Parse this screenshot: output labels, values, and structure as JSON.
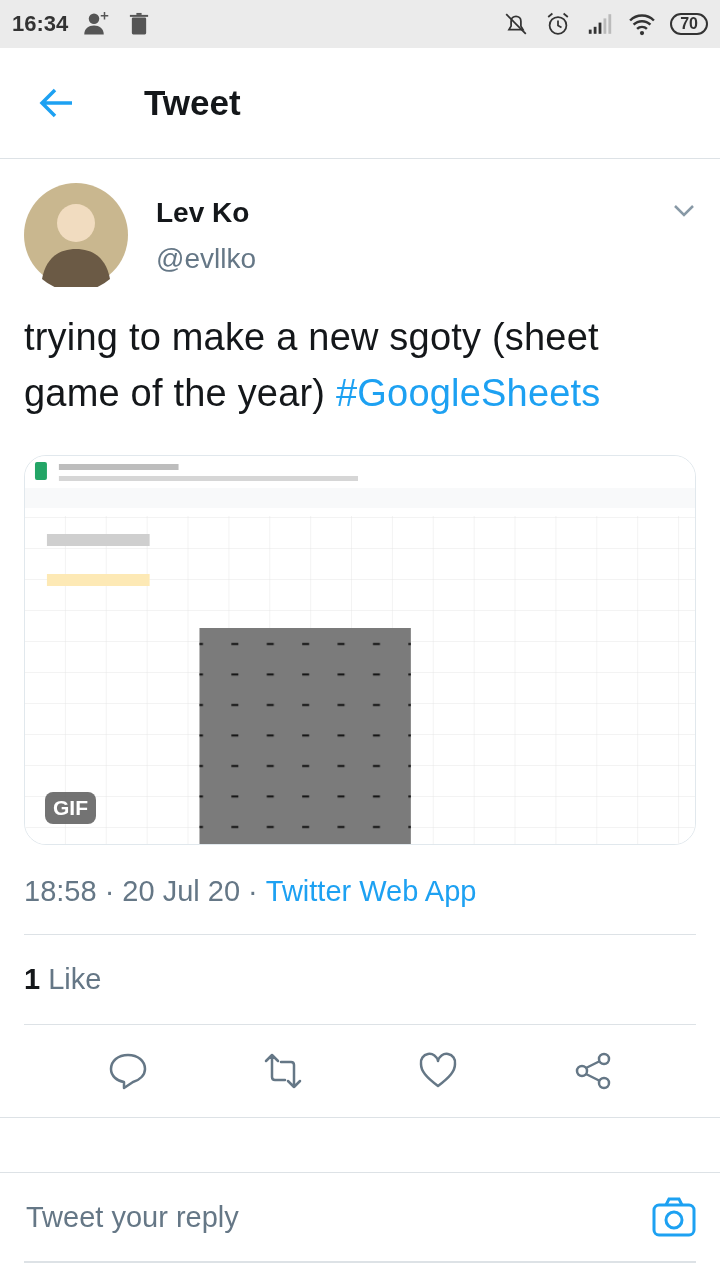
{
  "status_bar": {
    "time": "16:34",
    "battery": "70"
  },
  "header": {
    "title": "Tweet"
  },
  "tweet": {
    "author": {
      "name": "Lev Ko",
      "handle": "@evllko"
    },
    "text": "trying to make a new sgoty (sheet game of the year)",
    "hashtag": "#GoogleSheets",
    "media": {
      "kind": "picture",
      "badge": "GIF"
    },
    "timestamp": "18:58 · 20 Jul 20 ·",
    "source": "Twitter Web App",
    "likes": {
      "count": "1",
      "label": "Like"
    },
    "actions": [
      {
        "kind": "reply"
      },
      {
        "kind": "retweet"
      },
      {
        "kind": "like"
      },
      {
        "kind": "share"
      }
    ]
  },
  "reply": {
    "placeholder": "Tweet your reply"
  }
}
